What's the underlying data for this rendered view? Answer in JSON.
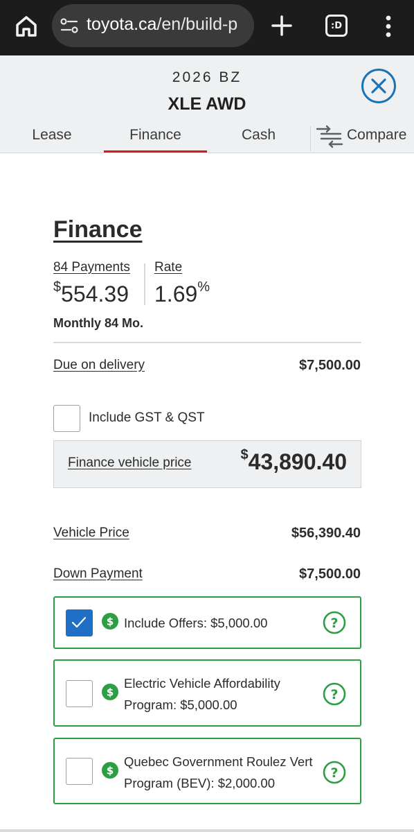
{
  "browser": {
    "url_host": "toyota.ca",
    "url_path": "/en/build-p",
    "tabs_count": ":D"
  },
  "model": {
    "year_name": "2026 BZ",
    "trim": "XLE AWD"
  },
  "tabs": [
    {
      "label": "Lease",
      "active": false
    },
    {
      "label": "Finance",
      "active": true
    },
    {
      "label": "Cash",
      "active": false
    },
    {
      "label": "Compare",
      "active": false
    }
  ],
  "finance": {
    "title": "Finance",
    "payments_label": "84 Payments",
    "payment_currency": "$",
    "payment_amount": "554.39",
    "rate_label": "Rate",
    "rate_value": "1.69",
    "rate_unit": "%",
    "monthly_note": "Monthly 84 Mo.",
    "due_label": "Due on delivery",
    "due_value": "$7,500.00",
    "gst_label": "Include GST & QST",
    "gst_checked": false,
    "vehicle_price_box_label": "Finance vehicle price",
    "vehicle_price_currency": "$",
    "vehicle_price_amount": "43,890.40",
    "msrp_label": "Vehicle Price",
    "msrp_value": "$56,390.40",
    "down_label": "Down Payment",
    "down_value": "$7,500.00"
  },
  "offers": [
    {
      "line1": "Include Offers: $5,000.00",
      "line2": "",
      "checked": true
    },
    {
      "line1": "Electric Vehicle Affordability",
      "line2": "Program: $5,000.00",
      "checked": false
    },
    {
      "line1": "Quebec Government Roulez Vert",
      "line2": "Program (BEV): $2,000.00",
      "checked": false
    }
  ],
  "colors": {
    "accent_red": "#d71920",
    "offer_green": "#2e9e45",
    "checkbox_blue": "#1f6fc6",
    "close_blue": "#1a73b5"
  }
}
